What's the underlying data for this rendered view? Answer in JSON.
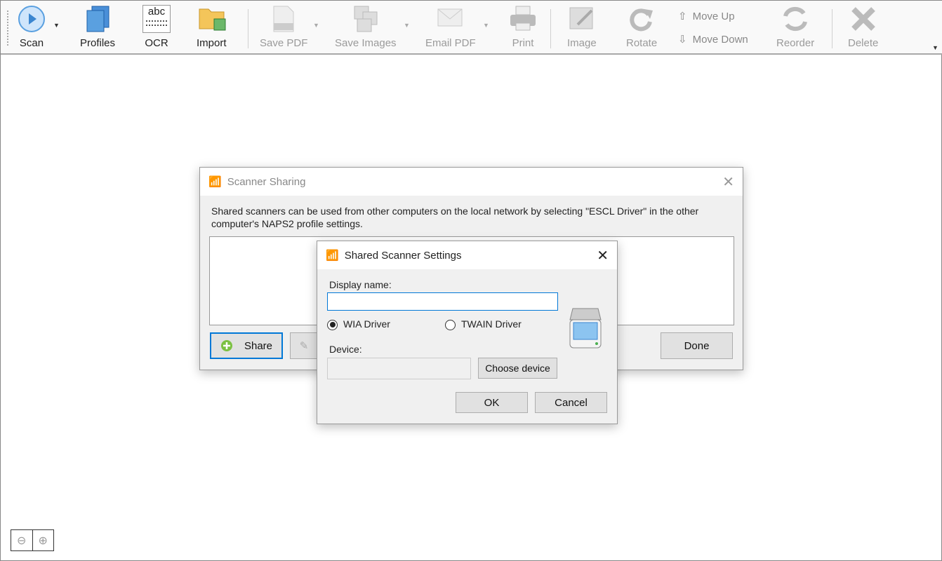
{
  "toolbar": {
    "scan": "Scan",
    "profiles": "Profiles",
    "ocr": "OCR",
    "ocr_icon_text": "abc",
    "import": "Import",
    "save_pdf": "Save PDF",
    "save_images": "Save Images",
    "email_pdf": "Email PDF",
    "print": "Print",
    "image": "Image",
    "rotate": "Rotate",
    "move_up": "Move Up",
    "move_down": "Move Down",
    "reorder": "Reorder",
    "delete": "Delete"
  },
  "sharing": {
    "title": "Scanner Sharing",
    "description": "Shared scanners can be used from other computers on the local network by selecting \"ESCL Driver\" in the other computer's NAPS2 profile settings.",
    "share": "Share",
    "done": "Done"
  },
  "settings": {
    "title": "Shared Scanner Settings",
    "display_name_label": "Display name:",
    "display_name_value": "",
    "wia": "WIA Driver",
    "twain": "TWAIN Driver",
    "selected_driver": "WIA Driver",
    "device_label": "Device:",
    "device_value": "",
    "choose_device": "Choose device",
    "ok": "OK",
    "cancel": "Cancel"
  },
  "colors": {
    "accent": "#0078d7",
    "scan_blue": "#5aa0e0"
  }
}
